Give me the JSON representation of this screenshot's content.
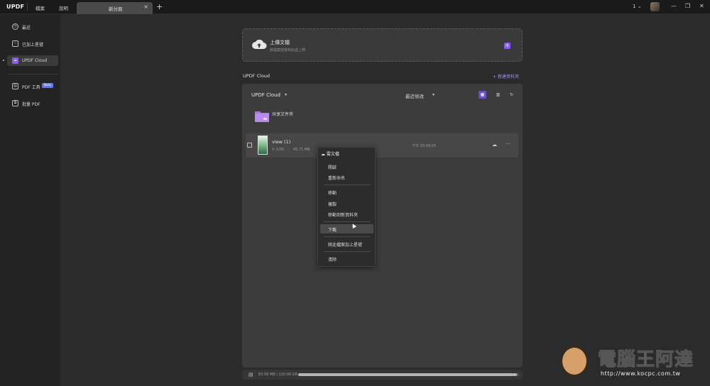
{
  "app": {
    "logo": "UPDF"
  },
  "menu": {
    "file": "檔案",
    "help": "說明"
  },
  "tabs": [
    {
      "label": "新分頁"
    }
  ],
  "window": {
    "page_indicator": "1"
  },
  "sidebar": {
    "items": [
      {
        "label": "最近"
      },
      {
        "label": "已加上星號"
      },
      {
        "label": "UPDF Cloud"
      },
      {
        "label": "PDF 工具",
        "badge": "New"
      },
      {
        "label": "批量 PDF"
      }
    ]
  },
  "upload": {
    "title": "上傳文檔",
    "subtitle": "將檔案拖曳到此處上傳"
  },
  "section": {
    "title": "UPDF Cloud",
    "new_folder": "新建資料夾"
  },
  "panel": {
    "location": "UPDF Cloud",
    "sort": "最近修改"
  },
  "folder": {
    "name": "共享文件夾"
  },
  "file": {
    "name": "view (1)",
    "pages": "1/30",
    "size": "45.71 MB",
    "time": "下午 03:09:25"
  },
  "context_menu": {
    "header": "雲文檔",
    "items": [
      "開啟",
      "重新命名",
      "移動",
      "複製",
      "移動到新資料夾",
      "下載",
      "將此檔案加上星號",
      "清除"
    ],
    "hover_index": 5
  },
  "storage": {
    "text": "63.09 MB | 110.00 GB",
    "used_fraction": 0.99
  },
  "watermark": {
    "title": "電腦王阿達",
    "url": "http://www.kocpc.com.tw"
  },
  "colors": {
    "accent": "#8a5cf6",
    "background": "#2b2b2b",
    "panel": "#3c3c3c"
  }
}
